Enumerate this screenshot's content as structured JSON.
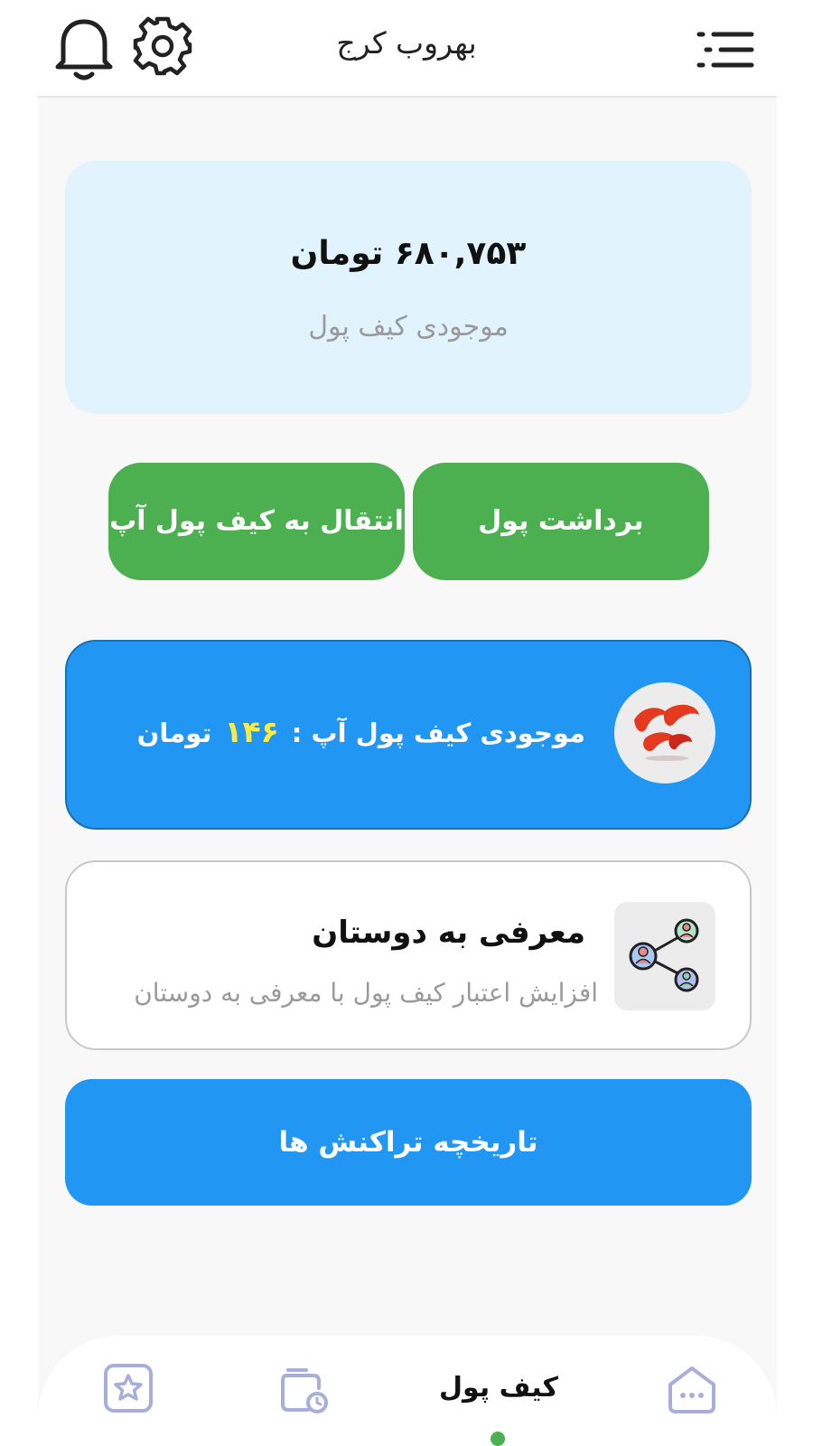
{
  "header": {
    "title": "بهروب کرج",
    "icons": [
      "bell-icon",
      "gear-icon",
      "menu-icon"
    ]
  },
  "balance": {
    "amount": "۶۸۰,۷۵۳ تومان",
    "label": "موجودی کیف پول"
  },
  "actions": {
    "withdraw_label": "برداشت پول",
    "transfer_label": "انتقال به کیف پول آپ"
  },
  "app_wallet": {
    "label": "موجودی کیف پول آپ :",
    "value": "۱۴۶",
    "unit": "تومان"
  },
  "referral": {
    "title": "معرفی به دوستان",
    "subtitle": "افزایش اعتبار کیف پول با معرفی به دوستان"
  },
  "history": {
    "label": "تاریخچه تراکنش ها"
  },
  "bottom_nav": {
    "active_label": "کیف پول",
    "items": [
      "favorites-icon",
      "wallet-icon",
      "home-icon"
    ]
  },
  "colors": {
    "green": "#4caf50",
    "blue": "#2196f3",
    "light_blue": "#e1f4fd",
    "highlight_yellow": "#ffeb3b"
  }
}
